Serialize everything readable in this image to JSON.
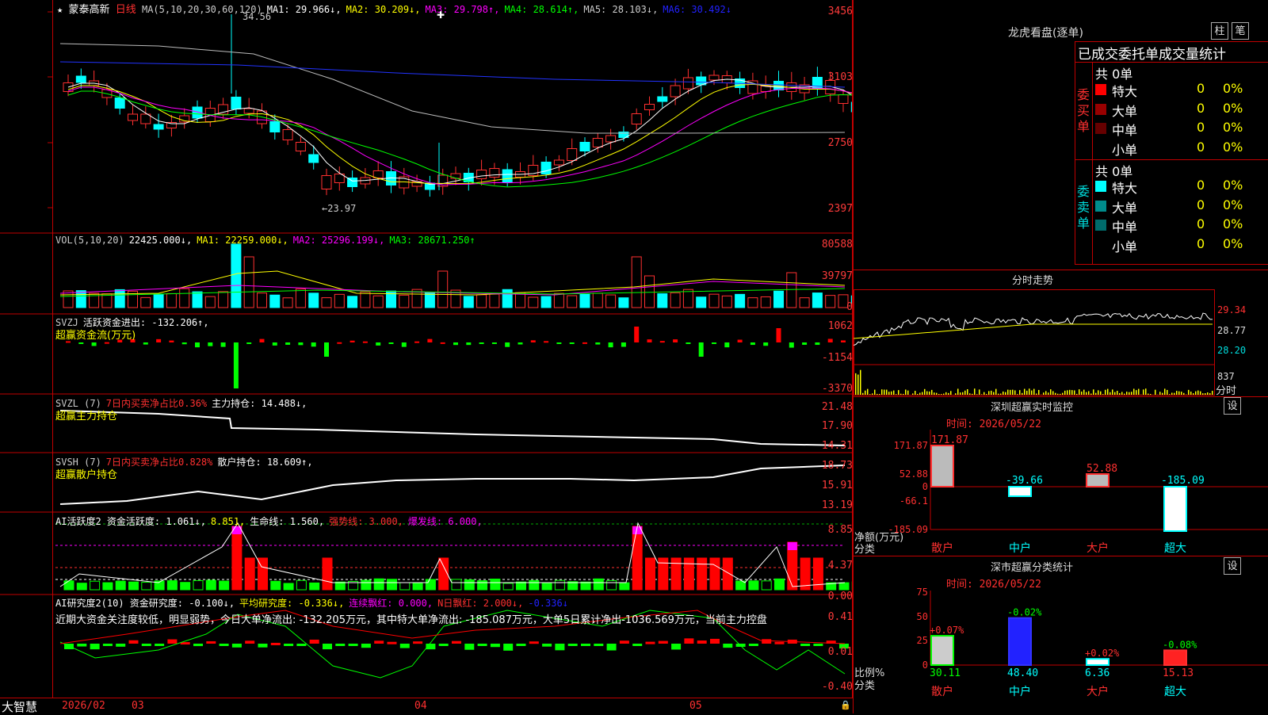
{
  "stock": {
    "star": "★",
    "name": "蒙泰高新",
    "period": "日线"
  },
  "kline": {
    "ma_header": [
      {
        "t": "MA(5,10,20,30,60,120)",
        "c": "#cccccc"
      },
      {
        "t": "MA1: 29.966↓,",
        "c": "#ffffff"
      },
      {
        "t": "MA2: 30.209↓,",
        "c": "#ffff00"
      },
      {
        "t": "MA3: 29.798↑,",
        "c": "#ff00ff"
      },
      {
        "t": "MA4: 28.614↑,",
        "c": "#00ff00"
      },
      {
        "t": "MA5: 28.103↓,",
        "c": "#cccccc"
      },
      {
        "t": "MA6: 30.492↓",
        "c": "#2222ff"
      }
    ],
    "y_labels": [
      "3456",
      "3103",
      "2750",
      "2397"
    ],
    "high_note": "34.56",
    "low_note": "←23.97"
  },
  "vol": {
    "header": [
      {
        "t": "VOL(5,10,20)",
        "c": "#cccccc"
      },
      {
        "t": "22425.000↓,",
        "c": "#ffffff"
      },
      {
        "t": "MA1: 22259.000↓,",
        "c": "#ffff00"
      },
      {
        "t": "MA2: 25296.199↓,",
        "c": "#ff00ff"
      },
      {
        "t": "MA3: 28671.250↑",
        "c": "#00ff00"
      }
    ],
    "y_labels": [
      "80588",
      "39797",
      "0"
    ]
  },
  "svzj": {
    "header": [
      {
        "t": "SVZJ",
        "c": "#cccccc"
      },
      {
        "t": "活跃资金进出: -132.206↑,",
        "c": "#ffffff"
      }
    ],
    "sub": "超赢资金流(万元)",
    "y_labels": [
      "1062",
      "-1154",
      "-3370"
    ]
  },
  "svzl": {
    "header": [
      {
        "t": "SVZL (7)",
        "c": "#cccccc"
      },
      {
        "t": "7日内买卖净占比0.36%",
        "c": "#ff3030"
      },
      {
        "t": "主力持仓: 14.488↓,",
        "c": "#ffffff"
      }
    ],
    "sub": "超赢主力持仓",
    "y_labels": [
      "21.48",
      "17.90",
      "14.31"
    ]
  },
  "svsh": {
    "header": [
      {
        "t": "SVSH (7)",
        "c": "#cccccc"
      },
      {
        "t": "7日内买卖净占比0.828%",
        "c": "#ff3030"
      },
      {
        "t": "散户持仓: 18.609↑,",
        "c": "#ffffff"
      }
    ],
    "sub": "超赢散户持仓",
    "y_labels": [
      "18.73",
      "15.91",
      "13.19"
    ]
  },
  "ai_active": {
    "header": [
      {
        "t": "AI活跃度2 资金活跃度: 1.061↓,",
        "c": "#ffffff"
      },
      {
        "t": "8.851,",
        "c": "#ffff00"
      },
      {
        "t": "生命线: 1.560,",
        "c": "#ffffff"
      },
      {
        "t": "强势线: 3.000,",
        "c": "#ff3030"
      },
      {
        "t": "爆发线: 6.000,",
        "c": "#ff00ff"
      }
    ],
    "y_labels": [
      "8.85",
      "4.37",
      "0.00"
    ]
  },
  "ai_research": {
    "header": [
      {
        "t": "AI研究度2(10) 资金研究度: -0.100↓,",
        "c": "#ffffff"
      },
      {
        "t": "平均研究度: -0.336↓,",
        "c": "#ffff00"
      },
      {
        "t": "连续飘红: 0.000,",
        "c": "#ff00ff"
      },
      {
        "t": "N日飘红: 2.000↓,",
        "c": "#ff3030"
      },
      {
        "t": "-0.336↓",
        "c": "#2222ff"
      }
    ],
    "text": "近期大资金关注度较低，明显弱势，今日大单净流出: -132.205万元，其中特大单净流出: -185.087万元，大单5日累计净出-1036.569万元，当前主力控盘",
    "y_labels": [
      "0.41",
      "0.01",
      "-0.40"
    ]
  },
  "bottom": {
    "brand": "大智慧",
    "dates": [
      "2026/02",
      "03",
      "04",
      "05"
    ]
  },
  "lhb": {
    "title": "龙虎看盘(逐单)",
    "btn1": "柱",
    "btn2": "笔",
    "tabs": "已成交委托单成交量统计",
    "buy_label": "委买单",
    "sell_label": "委卖单",
    "buy_count": "共 0单",
    "sell_count": "共 0单",
    "buy_rows": [
      {
        "label": "特大",
        "v": "0",
        "p": "0%",
        "c": "#ff0000"
      },
      {
        "label": "大单",
        "v": "0",
        "p": "0%",
        "c": "#990000"
      },
      {
        "label": "中单",
        "v": "0",
        "p": "0%",
        "c": "#660000"
      },
      {
        "label": "小单",
        "v": "0",
        "p": "0%",
        "c": ""
      }
    ],
    "sell_rows": [
      {
        "label": "特大",
        "v": "0",
        "p": "0%",
        "c": "#00ffff"
      },
      {
        "label": "大单",
        "v": "0",
        "p": "0%",
        "c": "#008b8b"
      },
      {
        "label": "中单",
        "v": "0",
        "p": "0%",
        "c": "#006b6b"
      },
      {
        "label": "小单",
        "v": "0",
        "p": "0%",
        "c": ""
      }
    ]
  },
  "intraday": {
    "title": "分时走势",
    "y_labels": [
      "29.34",
      "28.77",
      "28.20"
    ],
    "vol_label": "837",
    "x_label": "分时"
  },
  "sz_monitor": {
    "title": "深圳超赢实时监控",
    "btn": "设",
    "time": "时间: 2026/05/22",
    "y_labels": [
      "171.87",
      "52.88",
      "0",
      "-66.1",
      "-185.09"
    ],
    "bars": [
      {
        "label": "散户",
        "value": "171.87"
      },
      {
        "label": "中户",
        "value": "-39.66"
      },
      {
        "label": "大户",
        "value": "52.88"
      },
      {
        "label": "超大",
        "value": "-185.09"
      }
    ],
    "axis_title": "净额(万元)",
    "axis_sub": "分类"
  },
  "sz_class": {
    "title": "深市超赢分类统计",
    "btn": "设",
    "time": "时间: 2026/05/22",
    "y_labels": [
      "75",
      "50",
      "25",
      "0"
    ],
    "bars": [
      {
        "label": "散户",
        "value": "30.11",
        "change": "+0.07%"
      },
      {
        "label": "中户",
        "value": "48.40",
        "change": "-0.02%"
      },
      {
        "label": "大户",
        "value": "6.36",
        "change": "+0.02%"
      },
      {
        "label": "超大",
        "value": "15.13",
        "change": "-0.08%"
      }
    ],
    "axis_title": "比例%",
    "axis_sub": "分类"
  }
}
